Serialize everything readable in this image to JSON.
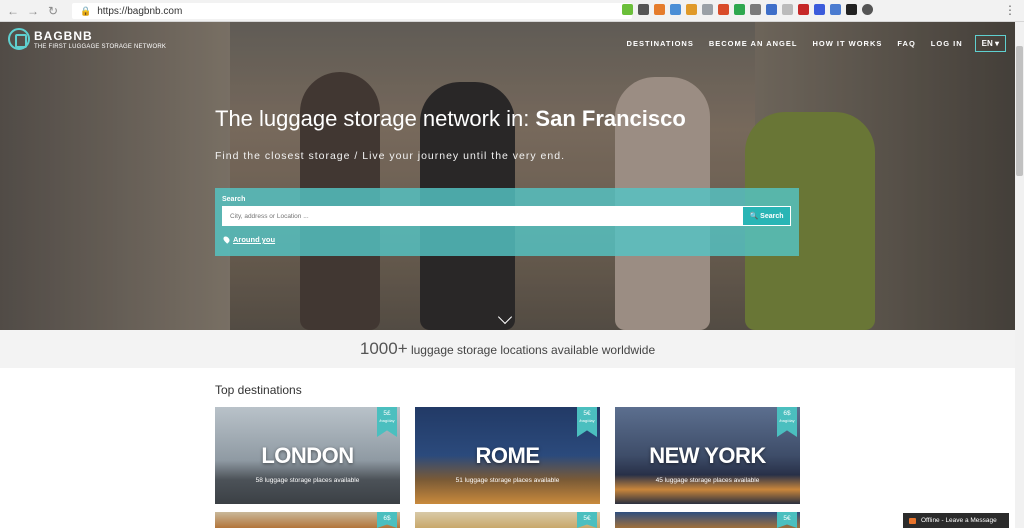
{
  "browser": {
    "url": "https://bagbnb.com"
  },
  "brand": {
    "name": "BAGBNB",
    "tagline": "THE FIRST LUGGAGE STORAGE NETWORK"
  },
  "nav": {
    "items": [
      {
        "label": "DESTINATIONS"
      },
      {
        "label": "BECOME AN ANGEL"
      },
      {
        "label": "HOW IT WORKS"
      },
      {
        "label": "FAQ"
      },
      {
        "label": "LOG IN"
      }
    ],
    "language": "EN ▾"
  },
  "hero": {
    "headline_prefix": "The luggage storage network in: ",
    "headline_city": "San Francisco",
    "subline": "Find the closest storage  /  Live your journey until the very end."
  },
  "search": {
    "label": "Search",
    "placeholder": "City, address or Location ...",
    "button_label": "🔍 Search",
    "around_you": "Around you"
  },
  "stats": {
    "count": "1000+",
    "text": " luggage storage locations available worldwide"
  },
  "destinations": {
    "title": "Top destinations",
    "cards": [
      {
        "city": "LONDON",
        "places": "58 luggage storage places available",
        "price": "5£",
        "unit": "/bag/day"
      },
      {
        "city": "ROME",
        "places": "51 luggage storage places available",
        "price": "5€",
        "unit": "/bag/day"
      },
      {
        "city": "NEW YORK",
        "places": "45 luggage storage places available",
        "price": "6$",
        "unit": "/bag/day"
      }
    ],
    "row2": [
      {
        "price": "6$"
      },
      {
        "price": "5€"
      },
      {
        "price": "5€"
      }
    ]
  },
  "chat": {
    "label": "Offline - Leave a Message"
  }
}
